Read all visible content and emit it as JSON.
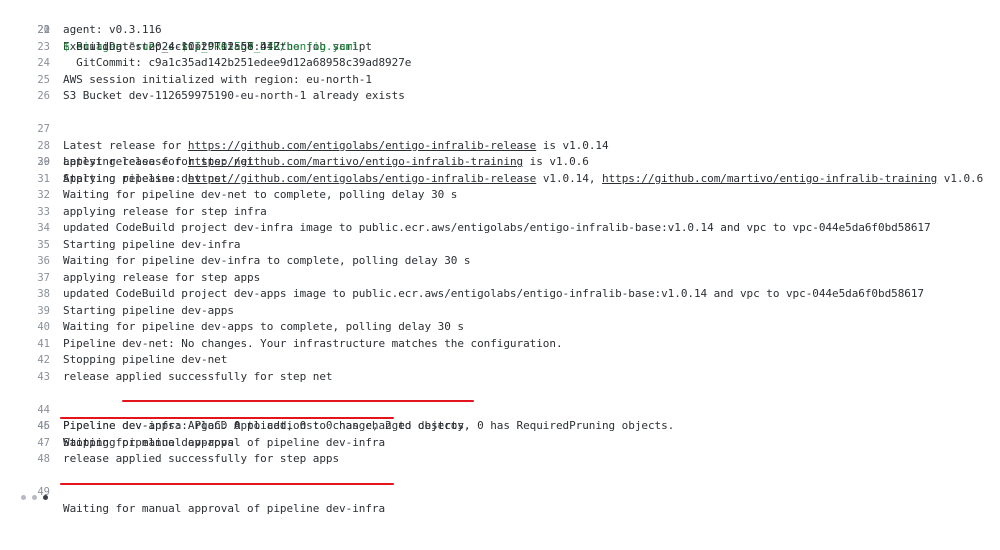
{
  "log": {
    "lines": [
      {
        "n": "20",
        "t": "Executing \"step_script\" stage of the job script"
      },
      {
        "n": "21",
        "t": "$ ei-agent run -c $CI_PROJECT_DIR/config.yaml"
      },
      {
        "n": "22",
        "t": "agent: v0.3.116"
      },
      {
        "n": "23",
        "t": "  BuildDate: 2024-10-29T12:58:44Z"
      },
      {
        "n": "24",
        "t": "  GitCommit: c9a1c35ad142b251edee9d12a68958c39ad8927e"
      },
      {
        "n": "25",
        "t": "AWS session initialized with region: eu-north-1"
      },
      {
        "n": "26",
        "t": "S3 Bucket dev-112659975190-eu-north-1 already exists"
      },
      {
        "n": "27",
        "a": "Latest release for ",
        "link": "https://github.com/entigolabs/entigo-infralib-release",
        "b": " is v1.0.14"
      },
      {
        "n": "28",
        "a": "Latest release for ",
        "link": "https://github.com/martivo/entigo-infralib-training",
        "b": " is v1.0.6"
      },
      {
        "n": "29",
        "a": "Applying releases: ",
        "link": "https://github.com/entigolabs/entigo-infralib-release",
        "b": " v1.0.14, ",
        "link2": "https://github.com/martivo/entigo-infralib-training",
        "c": " v1.0.6"
      },
      {
        "n": "30",
        "t": "applying release for step net"
      },
      {
        "n": "31",
        "t": "Starting pipeline dev-net"
      },
      {
        "n": "32",
        "t": "Waiting for pipeline dev-net to complete, polling delay 30 s"
      },
      {
        "n": "33",
        "t": "applying release for step infra"
      },
      {
        "n": "34",
        "t": "updated CodeBuild project dev-infra image to public.ecr.aws/entigolabs/entigo-infralib-base:v1.0.14 and vpc to vpc-044e5da6f0bd58617"
      },
      {
        "n": "35",
        "t": "Starting pipeline dev-infra"
      },
      {
        "n": "36",
        "t": "Waiting for pipeline dev-infra to complete, polling delay 30 s"
      },
      {
        "n": "37",
        "t": "applying release for step apps"
      },
      {
        "n": "38",
        "t": "updated CodeBuild project dev-apps image to public.ecr.aws/entigolabs/entigo-infralib-base:v1.0.14 and vpc to vpc-044e5da6f0bd58617"
      },
      {
        "n": "39",
        "t": "Starting pipeline dev-apps"
      },
      {
        "n": "40",
        "t": "Waiting for pipeline dev-apps to complete, polling delay 30 s"
      },
      {
        "n": "41",
        "t": "Pipeline dev-net: No changes. Your infrastructure matches the configuration."
      },
      {
        "n": "42",
        "t": "Stopping pipeline dev-net"
      },
      {
        "n": "43",
        "t": "release applied successfully for step net"
      },
      {
        "n": "44",
        "t": "Pipeline dev-infra: Plan: 0 to add, 0 to change, 2 to destroy."
      },
      {
        "n": "45",
        "t": "Waiting for manual approval of pipeline dev-infra"
      },
      {
        "n": "46",
        "t": "Pipeline dev-apps: ArgoCD Applications: 0 has changed objects, 0 has RequiredPruning objects."
      },
      {
        "n": "47",
        "t": "Stopping pipeline dev-apps"
      },
      {
        "n": "48",
        "t": "release applied successfully for step apps"
      },
      {
        "n": "49",
        "t": "Waiting for manual approval of pipeline dev-infra"
      }
    ]
  },
  "colors": {
    "command": "#1f8a3b",
    "highlight": "#e3141b",
    "text": "#2b2f33",
    "line_number": "#8a9099"
  },
  "icons": {
    "collapse": "caret-icon"
  }
}
